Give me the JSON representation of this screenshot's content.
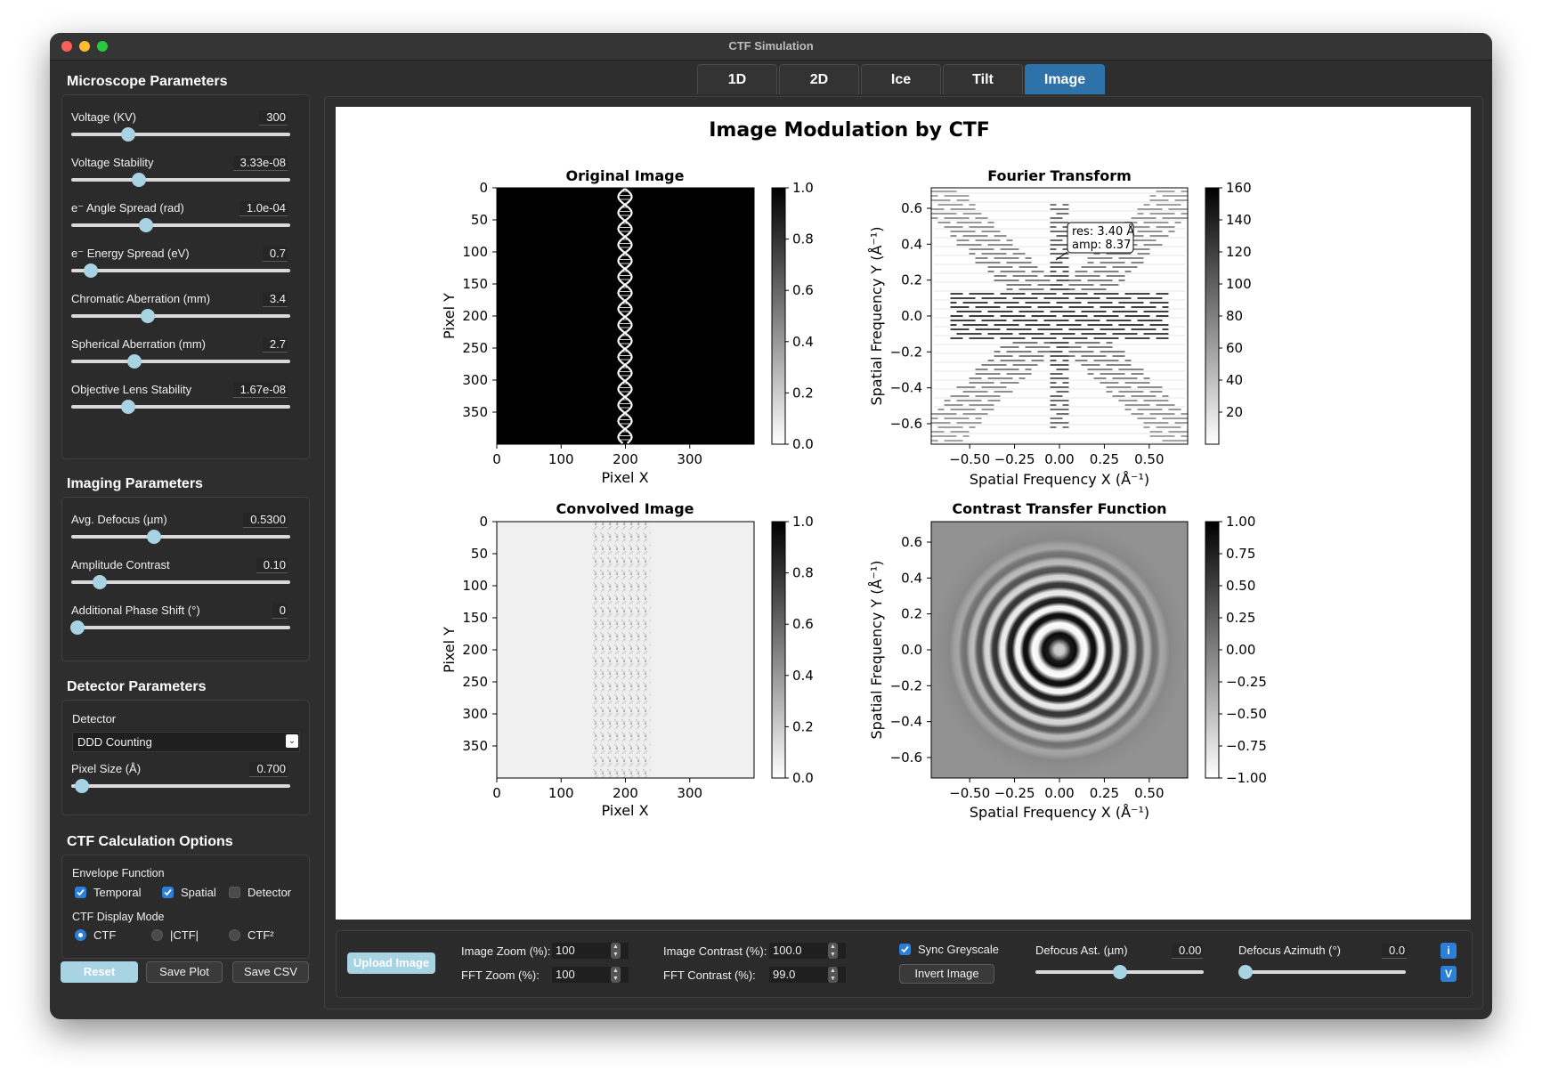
{
  "window": {
    "title": "CTF Simulation"
  },
  "microscope": {
    "title": "Microscope Parameters",
    "params": [
      {
        "label": "Voltage (KV)",
        "value": "300",
        "level": 0.26
      },
      {
        "label": "Voltage Stability",
        "value": "3.33e-08",
        "level": 0.31
      },
      {
        "label": "e⁻ Angle Spread (rad)",
        "value": "1.0e-04",
        "level": 0.34
      },
      {
        "label": "e⁻ Energy Spread (eV)",
        "value": "0.7",
        "level": 0.09
      },
      {
        "label": "Chromatic Aberration (mm)",
        "value": "3.4",
        "level": 0.35
      },
      {
        "label": "Spherical Aberration (mm)",
        "value": "2.7",
        "level": 0.29
      },
      {
        "label": "Objective Lens Stability",
        "value": "1.67e-08",
        "level": 0.26
      }
    ]
  },
  "imaging": {
    "title": "Imaging Parameters",
    "params": [
      {
        "label": "Avg. Defocus (µm)",
        "value": "0.5300",
        "level": 0.38
      },
      {
        "label": "Amplitude Contrast",
        "value": "0.10",
        "level": 0.13
      },
      {
        "label": "Additional Phase Shift (°)",
        "value": "0",
        "level": 0.03
      }
    ]
  },
  "detector": {
    "title": "Detector Parameters",
    "detector_label": "Detector",
    "detector_value": "DDD Counting",
    "pixel_label": "Pixel Size (Å)",
    "pixel_value": "0.700",
    "pixel_level": 0.05
  },
  "options": {
    "title": "CTF Calculation Options",
    "envelope_label": "Envelope Function",
    "temporal": "Temporal",
    "spatial": "Spatial",
    "detector": "Detector",
    "display_label": "CTF Display Mode",
    "mode_ctf": "CTF",
    "mode_abs": "|CTF|",
    "mode_sq": "CTF²"
  },
  "buttons": {
    "reset": "Reset",
    "save_plot": "Save Plot",
    "save_csv": "Save CSV"
  },
  "tabs": [
    "1D",
    "2D",
    "Ice",
    "Tilt",
    "Image"
  ],
  "bottom": {
    "upload": "Upload Image",
    "image_zoom_label": "Image Zoom (%):",
    "image_zoom": "100",
    "fft_zoom_label": "FFT Zoom (%):",
    "fft_zoom": "100",
    "image_contrast_label": "Image Contrast (%):",
    "image_contrast": "100.0",
    "fft_contrast_label": "FFT Contrast (%):",
    "fft_contrast": "99.0",
    "sync": "Sync Greyscale",
    "invert": "Invert Image",
    "defocus_ast_label": "Defocus Ast. (µm)",
    "defocus_ast": "0.00",
    "defocus_ast_level": 0.5,
    "defocus_az_label": "Defocus Azimuth (°)",
    "defocus_az": "0.0",
    "defocus_az_level": 0.0,
    "i_btn": "i",
    "v_btn": "V"
  },
  "chart_data": [
    {
      "type": "heatmap",
      "title": "Original Image",
      "suptitle": "Image Modulation by CTF",
      "xlabel": "Pixel X",
      "ylabel": "Pixel Y",
      "xticks": [
        0,
        100,
        200,
        300
      ],
      "yticks": [
        0,
        50,
        100,
        150,
        200,
        250,
        300,
        350
      ],
      "xlim": [
        0,
        400
      ],
      "ylim": [
        400,
        0
      ],
      "colorbar": {
        "ticks": [
          "0.0",
          "0.2",
          "0.4",
          "0.6",
          "0.8",
          "1.0"
        ],
        "range": [
          0,
          1
        ]
      },
      "cmap": "Greys"
    },
    {
      "type": "heatmap",
      "title": "Fourier Transform",
      "xlabel": "Spatial Frequency X (Å⁻¹)",
      "ylabel": "Spatial Frequency Y (Å⁻¹)",
      "xticks": [
        "−0.50",
        "−0.25",
        "0.00",
        "0.25",
        "0.50"
      ],
      "yticks": [
        "0.6",
        "0.4",
        "0.2",
        "0.0",
        "−0.2",
        "−0.4",
        "−0.6"
      ],
      "xlim": [
        -0.714,
        0.714
      ],
      "ylim": [
        -0.714,
        0.714
      ],
      "colorbar": {
        "ticks": [
          "20",
          "40",
          "60",
          "80",
          "100",
          "120",
          "140",
          "160"
        ],
        "range": [
          0,
          160
        ]
      },
      "annotation": {
        "line1": "res: 3.40 Å",
        "line2": "amp: 8.37",
        "x": 0.0,
        "y": 0.3
      },
      "cmap": "Greys"
    },
    {
      "type": "heatmap",
      "title": "Convolved Image",
      "xlabel": "Pixel X",
      "ylabel": "Pixel Y",
      "xticks": [
        0,
        100,
        200,
        300
      ],
      "yticks": [
        0,
        50,
        100,
        150,
        200,
        250,
        300,
        350
      ],
      "xlim": [
        0,
        400
      ],
      "ylim": [
        400,
        0
      ],
      "colorbar": {
        "ticks": [
          "0.0",
          "0.2",
          "0.4",
          "0.6",
          "0.8",
          "1.0"
        ],
        "range": [
          0,
          1
        ]
      },
      "cmap": "Greys"
    },
    {
      "type": "heatmap",
      "title": "Contrast Transfer Function",
      "xlabel": "Spatial Frequency X (Å⁻¹)",
      "ylabel": "Spatial Frequency Y (Å⁻¹)",
      "xticks": [
        "−0.50",
        "−0.25",
        "0.00",
        "0.25",
        "0.50"
      ],
      "yticks": [
        "0.6",
        "0.4",
        "0.2",
        "0.0",
        "−0.2",
        "−0.4",
        "−0.6"
      ],
      "xlim": [
        -0.714,
        0.714
      ],
      "ylim": [
        -0.714,
        0.714
      ],
      "colorbar": {
        "ticks": [
          "1.00",
          "0.75",
          "0.50",
          "0.25",
          "0.00",
          "−0.25",
          "−0.50",
          "−0.75",
          "−1.00"
        ],
        "range": [
          -1,
          1
        ]
      },
      "cmap": "Greys"
    }
  ]
}
